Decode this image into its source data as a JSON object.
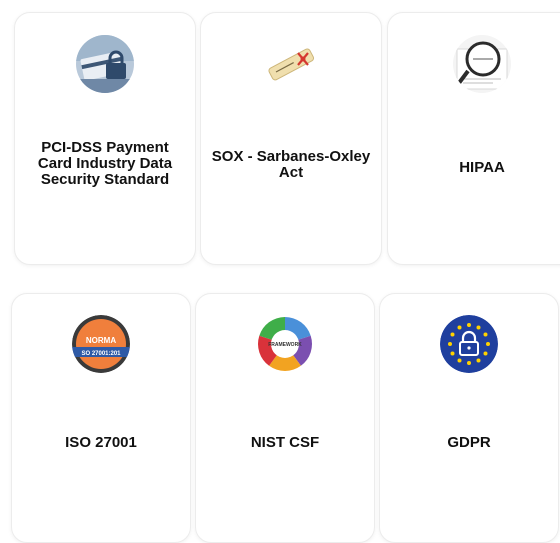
{
  "cards": [
    {
      "label": "PCI-DSS Payment Card Industry Data Security Standard",
      "icon": "credit-card-lock-icon"
    },
    {
      "label": "SOX - Sarbanes-Oxley Act",
      "icon": "document-scroll-icon"
    },
    {
      "label": "HIPAA",
      "icon": "magnifier-document-icon"
    },
    {
      "label": "ISO 27001",
      "icon": "iso-badge-icon",
      "icon_text": [
        "NORMA",
        "SO 27001:201"
      ]
    },
    {
      "label": "NIST CSF",
      "icon": "framework-wheel-icon",
      "icon_text": "FRAMEWORK"
    },
    {
      "label": "GDPR",
      "icon": "eu-lock-icon"
    }
  ],
  "colors": {
    "card_border": "#ececec",
    "label": "#111111",
    "iso_orange": "#f07f3c",
    "eu_blue": "#1f3f9e",
    "eu_star": "#ffd200"
  }
}
